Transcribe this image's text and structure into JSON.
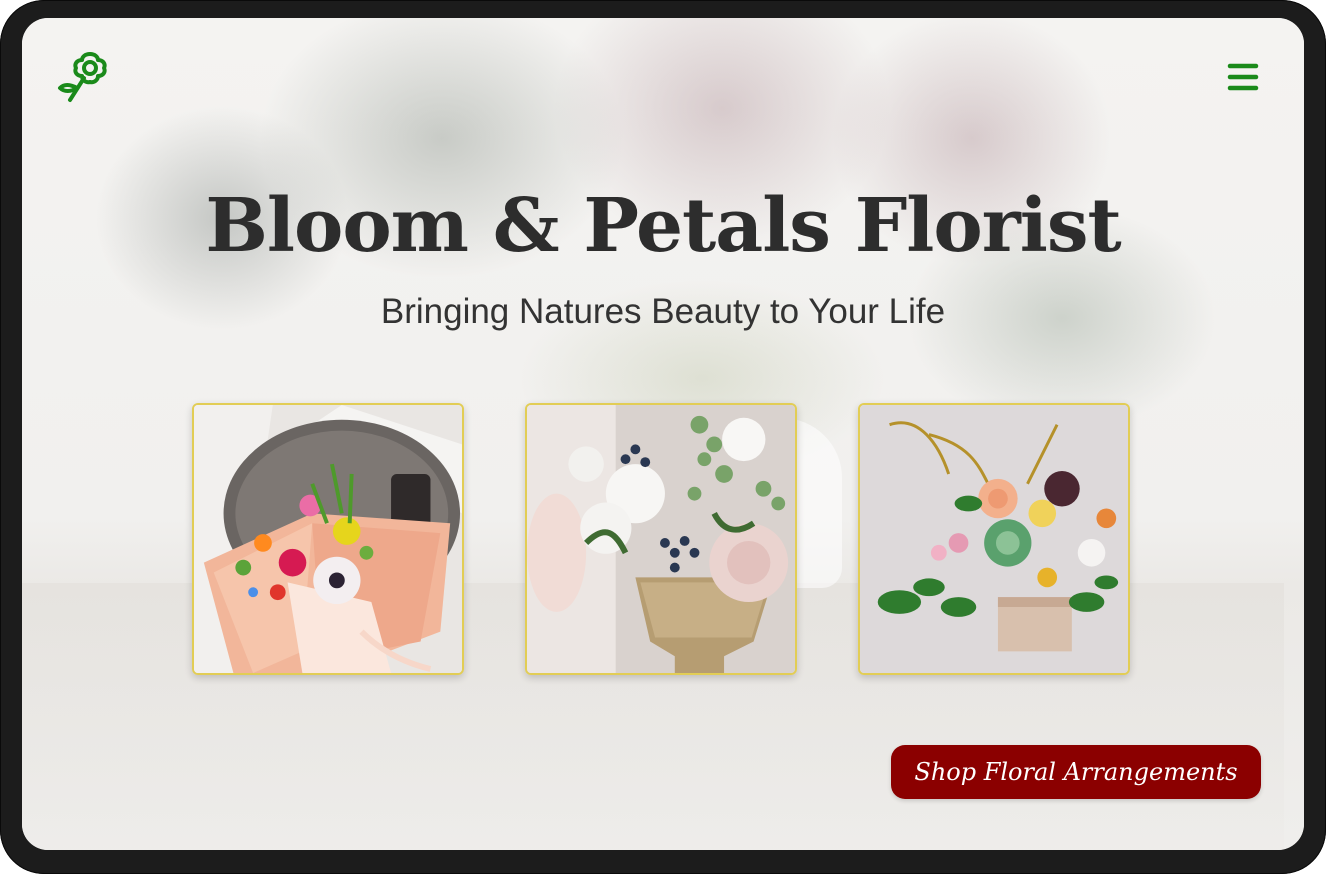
{
  "header": {
    "logo_icon": "flower-logo-icon",
    "menu_icon": "hamburger-menu-icon"
  },
  "hero": {
    "title": "Bloom & Petals Florist",
    "subtitle": "Bringing Natures Beauty to Your Life"
  },
  "gallery": {
    "items": [
      {
        "icon": "bouquet-photo"
      },
      {
        "icon": "centerpiece-photo"
      },
      {
        "icon": "wooden-box-arrangement-photo"
      }
    ]
  },
  "cta": {
    "label": "Shop Floral Arrangements"
  },
  "colors": {
    "accent_green": "#1a8a1a",
    "cta_red": "#8b0000",
    "card_border": "#e2cd55",
    "title_text": "#2d2d2d"
  }
}
